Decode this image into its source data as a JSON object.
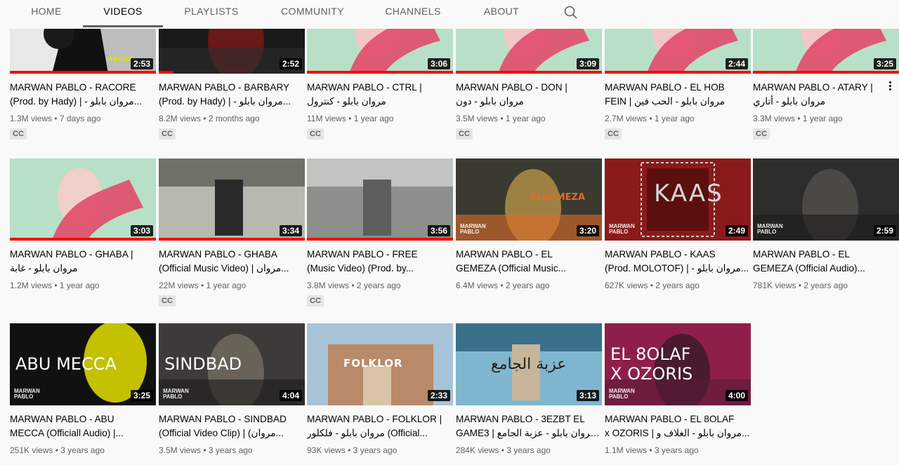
{
  "tabs": [
    {
      "label": "HOME",
      "active": false
    },
    {
      "label": "VIDEOS",
      "active": true
    },
    {
      "label": "PLAYLISTS",
      "active": false
    },
    {
      "label": "COMMUNITY",
      "active": false
    },
    {
      "label": "CHANNELS",
      "active": false
    },
    {
      "label": "ABOUT",
      "active": false
    }
  ],
  "icons": {
    "search": "search-icon",
    "more": "more-vert-icon",
    "queue": "play-icon"
  },
  "colors": {
    "accent": "#ff0000",
    "text": "#030303",
    "secondary": "#606060",
    "background": "#f9f9f9"
  },
  "videos": [
    {
      "line1": "MARWAN PABLO - RACORE",
      "line2": "(Prod. by Hady) | - مروان بابلو...",
      "meta": "1.3M views • 7 days ago",
      "duration": "2:53",
      "cc": "CC",
      "progress": 1.0,
      "overlay": "RACOR"
    },
    {
      "line1": "MARWAN PABLO - BARBARY",
      "line2": "(Prod. by Hady) | - مروان بابلو...",
      "meta": "8.2M views • 2 months ago",
      "duration": "2:52",
      "cc": "CC",
      "progress": 0.1
    },
    {
      "line1": "MARWAN PABLO - CTRL |",
      "line2": "مروان بابلو - كنترول",
      "meta": "11M views • 1 year ago",
      "duration": "3:06",
      "cc": "CC",
      "progress": 1.0
    },
    {
      "line1": "MARWAN PABLO - DON |",
      "line2": "مروان بابلو - دون",
      "meta": "3.5M views • 1 year ago",
      "duration": "3:09",
      "cc": "CC",
      "progress": 1.0
    },
    {
      "line1": "MARWAN PABLO - EL HOB",
      "line2": "FEIN | مروان بابلو - الحب فين",
      "meta": "2.7M views • 1 year ago",
      "duration": "2:44",
      "cc": "CC",
      "progress": 1.0
    },
    {
      "line1": "MARWAN PABLO - ATARY |",
      "line2": "مروان بابلو - أتاري",
      "meta": "3.3M views • 1 year ago",
      "duration": "3:25",
      "cc": "CC",
      "progress": 1.0
    },
    {
      "line1": "MARWAN PABLO - GHABA |",
      "line2": "مروان بابلو - غابة",
      "meta": "1.2M views • 1 year ago",
      "duration": "3:03",
      "cc": "",
      "progress": 1.0
    },
    {
      "line1": "MARWAN PABLO - GHABA",
      "line2": "(Official Music Video) | مروان...",
      "meta": "22M views • 1 year ago",
      "duration": "3:34",
      "cc": "CC",
      "progress": 1.0
    },
    {
      "line1": "MARWAN PABLO - FREE",
      "line2": "(Music Video) (Prod. by...",
      "meta": "3.8M views • 2 years ago",
      "duration": "3:56",
      "cc": "CC",
      "progress": 1.0
    },
    {
      "line1": "MARWAN PABLO - EL",
      "line2": "GEMEZA (Official Music...",
      "meta": "6.4M views • 2 years ago",
      "duration": "3:20",
      "cc": "",
      "progress": 0,
      "overlay": "ELGEMEZA",
      "brand": "MARWAN\nPABLO"
    },
    {
      "line1": "MARWAN PABLO - KAAS",
      "line2": "(Prod. MOLOTOF) | - مروان بابلو...",
      "meta": "627K views • 2 years ago",
      "duration": "2:49",
      "cc": "",
      "progress": 0,
      "overlay": "KAAS",
      "brand": "MARWAN\nPABLO"
    },
    {
      "line1": "MARWAN PABLO - EL",
      "line2": "GEMEZA (Official Audio)...",
      "meta": "781K views • 2 years ago",
      "duration": "2:59",
      "cc": "",
      "progress": 0,
      "brand": "MARWAN\nPABLO"
    },
    {
      "line1": "MARWAN PABLO - ABU",
      "line2": "MECCA (Officiall Audio) |...",
      "meta": "251K views • 3 years ago",
      "duration": "3:25",
      "cc": "",
      "progress": 0,
      "overlay": "ABU MECCA",
      "brand": "MARWAN\nPABLO"
    },
    {
      "line1": "MARWAN PABLO - SINDBAD",
      "line2": "(Official Video Clip) | (مروان...",
      "meta": "3.5M views • 3 years ago",
      "duration": "4:04",
      "cc": "",
      "progress": 0,
      "overlay": "SINDBAD",
      "brand": "MARWAN\nPABLO"
    },
    {
      "line1": "MARWAN PABLO - FOLKLOR |",
      "line2": "مروان بابلو - فلكلور (Official...",
      "meta": "93K views • 3 years ago",
      "duration": "2:33",
      "cc": "",
      "progress": 0,
      "overlay": "FOLKLOR"
    },
    {
      "line1": "MARWAN PABLO - 3EZBT EL",
      "line2": "GAME3 | مروان بابلو - عزبة الجامع...",
      "meta": "284K views • 3 years ago",
      "duration": "3:13",
      "cc": "",
      "progress": 0,
      "overlay": "عزبة الجامع"
    },
    {
      "line1": "MARWAN PABLO - EL 8OLAF",
      "line2": "x OZORIS | مروان بابلو - الغلاف و...",
      "meta": "1.1M views • 3 years ago",
      "duration": "4:00",
      "cc": "",
      "progress": 0,
      "overlay": "EL 8OLAF\nX OZORIS",
      "brand": "MARWAN\nPABLO"
    }
  ]
}
